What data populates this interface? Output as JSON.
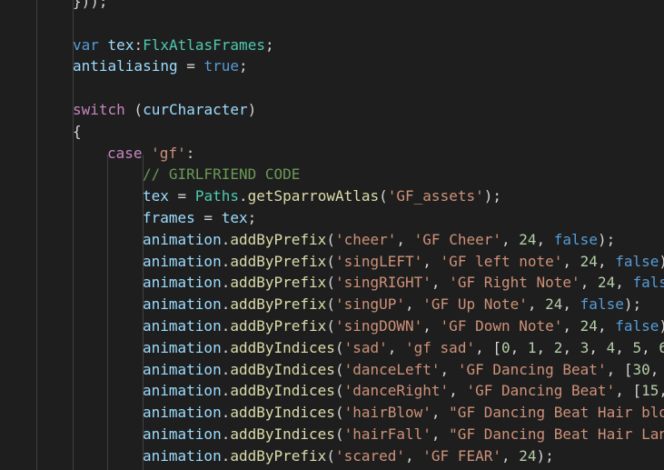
{
  "colors": {
    "background": "#1e1e1e",
    "keyword": "#569cd6",
    "control": "#c586c0",
    "variable": "#9cdcfe",
    "type": "#4ec9b0",
    "function": "#dcdcaa",
    "string": "#ce9178",
    "number": "#b5cea8",
    "comment": "#6a9955",
    "text": "#d4d4d4"
  },
  "code": {
    "lines": [
      {
        "indent": 2,
        "tokens": [
          {
            "t": "}",
            "c": "punc"
          },
          {
            "t": "));",
            "c": "punc"
          }
        ]
      },
      {
        "indent": 0,
        "tokens": []
      },
      {
        "indent": 2,
        "tokens": [
          {
            "t": "var",
            "c": "kw"
          },
          {
            "t": " ",
            "c": "punc"
          },
          {
            "t": "tex",
            "c": "var"
          },
          {
            "t": ":",
            "c": "punc"
          },
          {
            "t": "FlxAtlasFrames",
            "c": "type"
          },
          {
            "t": ";",
            "c": "punc"
          }
        ]
      },
      {
        "indent": 2,
        "tokens": [
          {
            "t": "antialiasing",
            "c": "var"
          },
          {
            "t": " = ",
            "c": "punc"
          },
          {
            "t": "true",
            "c": "kw"
          },
          {
            "t": ";",
            "c": "punc"
          }
        ]
      },
      {
        "indent": 0,
        "tokens": []
      },
      {
        "indent": 2,
        "tokens": [
          {
            "t": "switch",
            "c": "ctrl"
          },
          {
            "t": " (",
            "c": "punc"
          },
          {
            "t": "curCharacter",
            "c": "var"
          },
          {
            "t": ")",
            "c": "punc"
          }
        ]
      },
      {
        "indent": 2,
        "tokens": [
          {
            "t": "{",
            "c": "punc"
          }
        ]
      },
      {
        "indent": 3,
        "tokens": [
          {
            "t": "case",
            "c": "ctrl"
          },
          {
            "t": " ",
            "c": "punc"
          },
          {
            "t": "'gf'",
            "c": "str"
          },
          {
            "t": ":",
            "c": "punc"
          }
        ]
      },
      {
        "indent": 4,
        "tokens": [
          {
            "t": "// GIRLFRIEND CODE",
            "c": "com"
          }
        ]
      },
      {
        "indent": 4,
        "tokens": [
          {
            "t": "tex",
            "c": "var"
          },
          {
            "t": " = ",
            "c": "punc"
          },
          {
            "t": "Paths",
            "c": "type"
          },
          {
            "t": ".",
            "c": "punc"
          },
          {
            "t": "getSparrowAtlas",
            "c": "fn"
          },
          {
            "t": "(",
            "c": "punc"
          },
          {
            "t": "'GF_assets'",
            "c": "str"
          },
          {
            "t": ");",
            "c": "punc"
          }
        ]
      },
      {
        "indent": 4,
        "tokens": [
          {
            "t": "frames",
            "c": "var"
          },
          {
            "t": " = ",
            "c": "punc"
          },
          {
            "t": "tex",
            "c": "var"
          },
          {
            "t": ";",
            "c": "punc"
          }
        ]
      },
      {
        "indent": 4,
        "tokens": [
          {
            "t": "animation",
            "c": "var"
          },
          {
            "t": ".",
            "c": "punc"
          },
          {
            "t": "addByPrefix",
            "c": "fn"
          },
          {
            "t": "(",
            "c": "punc"
          },
          {
            "t": "'cheer'",
            "c": "str"
          },
          {
            "t": ", ",
            "c": "punc"
          },
          {
            "t": "'GF Cheer'",
            "c": "str"
          },
          {
            "t": ", ",
            "c": "punc"
          },
          {
            "t": "24",
            "c": "num"
          },
          {
            "t": ", ",
            "c": "punc"
          },
          {
            "t": "false",
            "c": "kw"
          },
          {
            "t": ");",
            "c": "punc"
          }
        ]
      },
      {
        "indent": 4,
        "tokens": [
          {
            "t": "animation",
            "c": "var"
          },
          {
            "t": ".",
            "c": "punc"
          },
          {
            "t": "addByPrefix",
            "c": "fn"
          },
          {
            "t": "(",
            "c": "punc"
          },
          {
            "t": "'singLEFT'",
            "c": "str"
          },
          {
            "t": ", ",
            "c": "punc"
          },
          {
            "t": "'GF left note'",
            "c": "str"
          },
          {
            "t": ", ",
            "c": "punc"
          },
          {
            "t": "24",
            "c": "num"
          },
          {
            "t": ", ",
            "c": "punc"
          },
          {
            "t": "false",
            "c": "kw"
          },
          {
            "t": ")",
            "c": "punc"
          }
        ]
      },
      {
        "indent": 4,
        "tokens": [
          {
            "t": "animation",
            "c": "var"
          },
          {
            "t": ".",
            "c": "punc"
          },
          {
            "t": "addByPrefix",
            "c": "fn"
          },
          {
            "t": "(",
            "c": "punc"
          },
          {
            "t": "'singRIGHT'",
            "c": "str"
          },
          {
            "t": ", ",
            "c": "punc"
          },
          {
            "t": "'GF Right Note'",
            "c": "str"
          },
          {
            "t": ", ",
            "c": "punc"
          },
          {
            "t": "24",
            "c": "num"
          },
          {
            "t": ", ",
            "c": "punc"
          },
          {
            "t": "fals",
            "c": "kw"
          }
        ]
      },
      {
        "indent": 4,
        "tokens": [
          {
            "t": "animation",
            "c": "var"
          },
          {
            "t": ".",
            "c": "punc"
          },
          {
            "t": "addByPrefix",
            "c": "fn"
          },
          {
            "t": "(",
            "c": "punc"
          },
          {
            "t": "'singUP'",
            "c": "str"
          },
          {
            "t": ", ",
            "c": "punc"
          },
          {
            "t": "'GF Up Note'",
            "c": "str"
          },
          {
            "t": ", ",
            "c": "punc"
          },
          {
            "t": "24",
            "c": "num"
          },
          {
            "t": ", ",
            "c": "punc"
          },
          {
            "t": "false",
            "c": "kw"
          },
          {
            "t": ");",
            "c": "punc"
          }
        ]
      },
      {
        "indent": 4,
        "tokens": [
          {
            "t": "animation",
            "c": "var"
          },
          {
            "t": ".",
            "c": "punc"
          },
          {
            "t": "addByPrefix",
            "c": "fn"
          },
          {
            "t": "(",
            "c": "punc"
          },
          {
            "t": "'singDOWN'",
            "c": "str"
          },
          {
            "t": ", ",
            "c": "punc"
          },
          {
            "t": "'GF Down Note'",
            "c": "str"
          },
          {
            "t": ", ",
            "c": "punc"
          },
          {
            "t": "24",
            "c": "num"
          },
          {
            "t": ", ",
            "c": "punc"
          },
          {
            "t": "false",
            "c": "kw"
          },
          {
            "t": ")",
            "c": "punc"
          }
        ]
      },
      {
        "indent": 4,
        "tokens": [
          {
            "t": "animation",
            "c": "var"
          },
          {
            "t": ".",
            "c": "punc"
          },
          {
            "t": "addByIndices",
            "c": "fn"
          },
          {
            "t": "(",
            "c": "punc"
          },
          {
            "t": "'sad'",
            "c": "str"
          },
          {
            "t": ", ",
            "c": "punc"
          },
          {
            "t": "'gf sad'",
            "c": "str"
          },
          {
            "t": ", [",
            "c": "punc"
          },
          {
            "t": "0",
            "c": "num"
          },
          {
            "t": ", ",
            "c": "punc"
          },
          {
            "t": "1",
            "c": "num"
          },
          {
            "t": ", ",
            "c": "punc"
          },
          {
            "t": "2",
            "c": "num"
          },
          {
            "t": ", ",
            "c": "punc"
          },
          {
            "t": "3",
            "c": "num"
          },
          {
            "t": ", ",
            "c": "punc"
          },
          {
            "t": "4",
            "c": "num"
          },
          {
            "t": ", ",
            "c": "punc"
          },
          {
            "t": "5",
            "c": "num"
          },
          {
            "t": ", ",
            "c": "punc"
          },
          {
            "t": "6",
            "c": "num"
          }
        ]
      },
      {
        "indent": 4,
        "tokens": [
          {
            "t": "animation",
            "c": "var"
          },
          {
            "t": ".",
            "c": "punc"
          },
          {
            "t": "addByIndices",
            "c": "fn"
          },
          {
            "t": "(",
            "c": "punc"
          },
          {
            "t": "'danceLeft'",
            "c": "str"
          },
          {
            "t": ", ",
            "c": "punc"
          },
          {
            "t": "'GF Dancing Beat'",
            "c": "str"
          },
          {
            "t": ", [",
            "c": "punc"
          },
          {
            "t": "30",
            "c": "num"
          },
          {
            "t": ",",
            "c": "punc"
          }
        ]
      },
      {
        "indent": 4,
        "tokens": [
          {
            "t": "animation",
            "c": "var"
          },
          {
            "t": ".",
            "c": "punc"
          },
          {
            "t": "addByIndices",
            "c": "fn"
          },
          {
            "t": "(",
            "c": "punc"
          },
          {
            "t": "'danceRight'",
            "c": "str"
          },
          {
            "t": ", ",
            "c": "punc"
          },
          {
            "t": "'GF Dancing Beat'",
            "c": "str"
          },
          {
            "t": ", [",
            "c": "punc"
          },
          {
            "t": "15",
            "c": "num"
          },
          {
            "t": ",",
            "c": "punc"
          }
        ]
      },
      {
        "indent": 4,
        "tokens": [
          {
            "t": "animation",
            "c": "var"
          },
          {
            "t": ".",
            "c": "punc"
          },
          {
            "t": "addByIndices",
            "c": "fn"
          },
          {
            "t": "(",
            "c": "punc"
          },
          {
            "t": "'hairBlow'",
            "c": "str"
          },
          {
            "t": ", ",
            "c": "punc"
          },
          {
            "t": "\"GF Dancing Beat Hair blo",
            "c": "str"
          }
        ]
      },
      {
        "indent": 4,
        "tokens": [
          {
            "t": "animation",
            "c": "var"
          },
          {
            "t": ".",
            "c": "punc"
          },
          {
            "t": "addByIndices",
            "c": "fn"
          },
          {
            "t": "(",
            "c": "punc"
          },
          {
            "t": "'hairFall'",
            "c": "str"
          },
          {
            "t": ", ",
            "c": "punc"
          },
          {
            "t": "\"GF Dancing Beat Hair Lan",
            "c": "str"
          }
        ]
      },
      {
        "indent": 4,
        "tokens": [
          {
            "t": "animation",
            "c": "var"
          },
          {
            "t": ".",
            "c": "punc"
          },
          {
            "t": "addByPrefix",
            "c": "fn"
          },
          {
            "t": "(",
            "c": "punc"
          },
          {
            "t": "'scared'",
            "c": "str"
          },
          {
            "t": ", ",
            "c": "punc"
          },
          {
            "t": "'GF FEAR'",
            "c": "str"
          },
          {
            "t": ", ",
            "c": "punc"
          },
          {
            "t": "24",
            "c": "num"
          },
          {
            "t": ");",
            "c": "punc"
          }
        ]
      }
    ]
  }
}
